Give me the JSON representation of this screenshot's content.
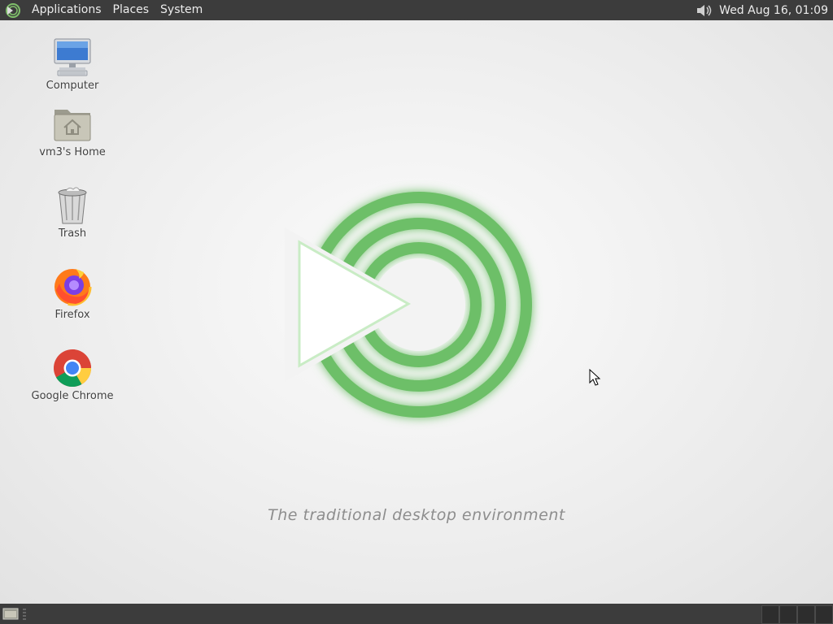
{
  "top_panel": {
    "menus": [
      "Applications",
      "Places",
      "System"
    ],
    "clock": "Wed Aug 16, 01:09",
    "volume_icon": "speaker-icon",
    "logo_icon": "mate-logo-icon"
  },
  "desktop": {
    "icons": [
      {
        "label": "Computer",
        "icon": "computer-icon"
      },
      {
        "label": "vm3's Home",
        "icon": "home-folder-icon"
      },
      {
        "label": "Trash",
        "icon": "trash-icon"
      },
      {
        "label": "Firefox",
        "icon": "firefox-icon"
      },
      {
        "label": "Google Chrome",
        "icon": "chrome-icon"
      }
    ],
    "tagline": "The traditional desktop environment"
  },
  "bottom_panel": {
    "show_desktop_icon": "show-desktop-icon",
    "workspaces": 4
  },
  "colors": {
    "panel": "#3c3c3c",
    "logo_green": "#6dbf67",
    "tagline": "#8d8d8d"
  }
}
